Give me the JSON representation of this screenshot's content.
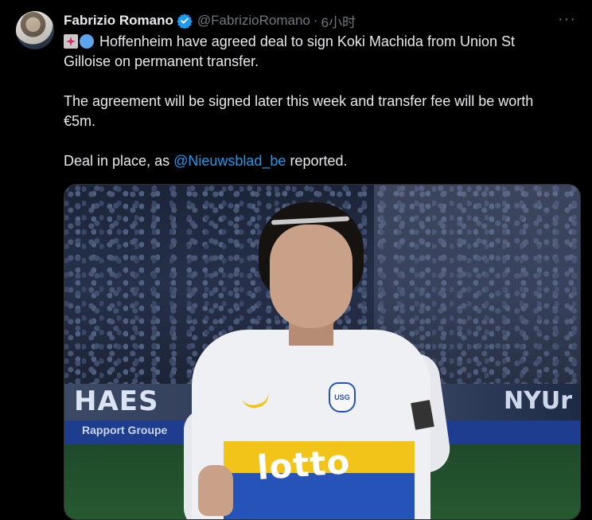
{
  "tweet": {
    "author": {
      "display_name": "Fabrizio Romano",
      "handle": "@FabrizioRomano",
      "verified": true
    },
    "separator": "·",
    "time": "6小时",
    "more_label": "···",
    "lines": {
      "l1": "Hoffenheim have agreed deal to sign Koki Machida from Union St",
      "l2": "Gilloise on permanent transfer.",
      "l3": "The agreement will be signed later this week and transfer fee will be worth",
      "l4": "€5m.",
      "l5_before": "Deal in place, as ",
      "l5_mention": "@Nieuwsblad_be",
      "l5_after": " reported."
    },
    "emoji": [
      "rotating-light-icon",
      "blue-circle-icon"
    ],
    "media": {
      "board_text": "HAES",
      "board_text_right": "NYUr",
      "board2_text": "Rapport Groupe",
      "shirt_sponsor": "lotto",
      "crest_text": "USG"
    }
  },
  "colors": {
    "background": "#000000",
    "text": "#e7e9ea",
    "muted": "#71767b",
    "link": "#1d9bf0",
    "verified": "#1d9bf0"
  }
}
